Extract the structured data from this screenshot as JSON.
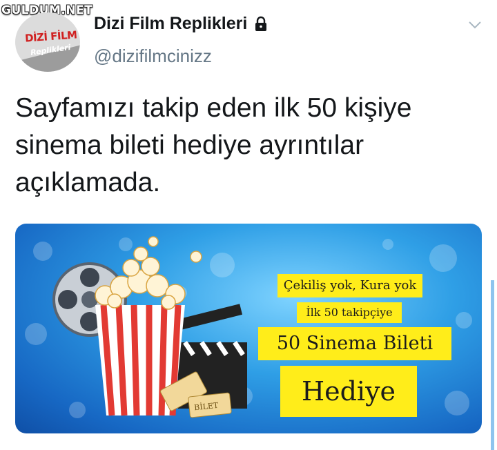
{
  "watermark": "GULDUM.NET",
  "profile": {
    "avatar_brand_line1": "DİZİ FİLM",
    "avatar_brand_line2": "Replikleri",
    "display_name": "Dizi Film Replikleri",
    "handle": "@dizifilmcinizz",
    "protected_icon": "lock-icon",
    "menu_icon": "chevron-down-icon"
  },
  "tweet": {
    "text_line1": "Sayfamızı takip eden ilk 50 kişiye",
    "text_line2": "sinema bileti hediye ayrıntılar",
    "text_line3": "açıklamada."
  },
  "media": {
    "promo_line1": "Çekiliş yok, Kura yok",
    "promo_line2": "İlk 50 takipçiye",
    "promo_line3": "50 Sinema Bileti",
    "promo_line4": "Hediye",
    "ticket_label": "BİLET",
    "colors": {
      "banner": "#ffed1a",
      "popcorn_stripe": "#e23a33",
      "background": "#2f9fe6"
    }
  }
}
